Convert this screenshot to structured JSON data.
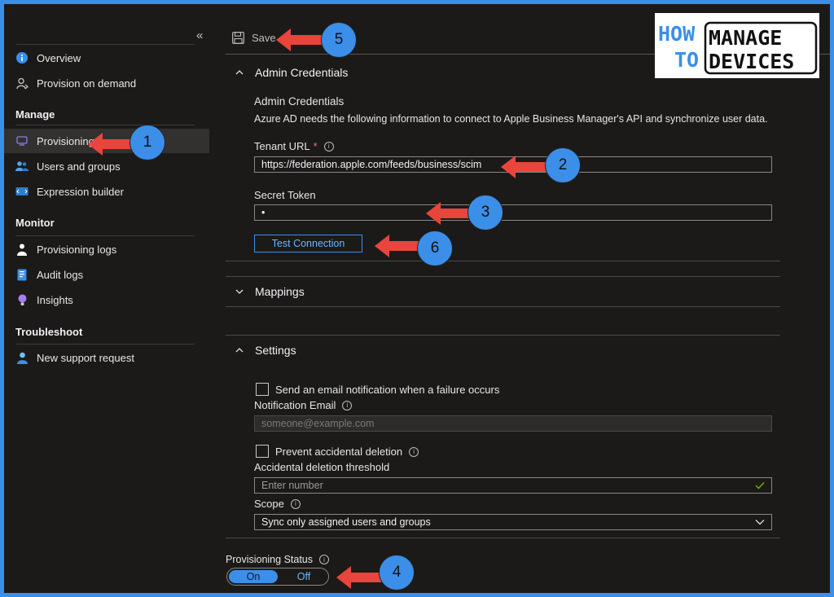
{
  "sidebar": {
    "collapse_glyph": "«",
    "items_top": [
      {
        "label": "Overview",
        "icon": "info-icon"
      },
      {
        "label": "Provision on demand",
        "icon": "provision-on-demand-icon"
      }
    ],
    "manage": {
      "heading": "Manage",
      "items": [
        {
          "label": "Provisioning",
          "icon": "provisioning-icon",
          "selected": true
        },
        {
          "label": "Users and groups",
          "icon": "users-icon"
        },
        {
          "label": "Expression builder",
          "icon": "expression-builder-icon"
        }
      ]
    },
    "monitor": {
      "heading": "Monitor",
      "items": [
        {
          "label": "Provisioning logs",
          "icon": "provisioning-logs-icon"
        },
        {
          "label": "Audit logs",
          "icon": "audit-logs-icon"
        },
        {
          "label": "Insights",
          "icon": "insights-icon"
        }
      ]
    },
    "troubleshoot": {
      "heading": "Troubleshoot",
      "items": [
        {
          "label": "New support request",
          "icon": "support-icon"
        }
      ]
    }
  },
  "toolbar": {
    "save_label": "Save"
  },
  "admin": {
    "section_title": "Admin Credentials",
    "subtitle": "Admin Credentials",
    "description": "Azure AD needs the following information to connect to Apple Business Manager's API and synchronize user data.",
    "tenant_url_label": "Tenant URL",
    "required_mark": "*",
    "tenant_url_value": "https://federation.apple.com/feeds/business/scim",
    "secret_token_label": "Secret Token",
    "secret_token_value": "•",
    "test_connection_label": "Test Connection"
  },
  "mappings": {
    "section_title": "Mappings"
  },
  "settings": {
    "section_title": "Settings",
    "email_checkbox_label": "Send an email notification when a failure occurs",
    "notification_email_label": "Notification Email",
    "notification_email_placeholder": "someone@example.com",
    "deletion_checkbox_label": "Prevent accidental deletion",
    "threshold_label": "Accidental deletion threshold",
    "threshold_placeholder": "Enter number",
    "scope_label": "Scope",
    "scope_value": "Sync only assigned users and groups"
  },
  "provisioning_status": {
    "label": "Provisioning Status",
    "on_label": "On",
    "off_label": "Off",
    "value": "On"
  },
  "annotations": [
    "1",
    "2",
    "3",
    "4",
    "5",
    "6"
  ],
  "logo": {
    "how": "HOW",
    "to": "TO",
    "manage": "MANAGE",
    "devices": "DEVICES"
  },
  "colors": {
    "accent": "#3b8fe8",
    "arrow": "#e8453c",
    "background": "#1b1a19"
  }
}
